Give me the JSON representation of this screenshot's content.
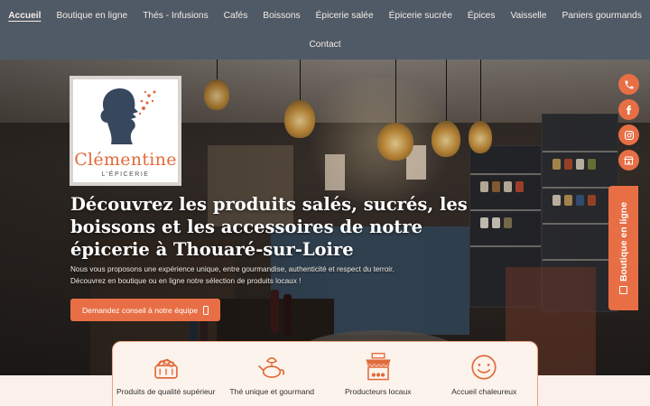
{
  "nav": {
    "items": [
      {
        "label": "Accueil",
        "active": true
      },
      {
        "label": "Boutique en ligne"
      },
      {
        "label": "Thés - Infusions"
      },
      {
        "label": "Cafés"
      },
      {
        "label": "Boissons"
      },
      {
        "label": "Épicerie salée"
      },
      {
        "label": "Épicerie sucrée"
      },
      {
        "label": "Épices"
      },
      {
        "label": "Vaisselle"
      },
      {
        "label": "Paniers gourmands"
      }
    ],
    "contact_label": "Contact"
  },
  "logo": {
    "name": "Clémentine",
    "subtitle": "L'ÉPICERIE"
  },
  "hero": {
    "title": "Découvrez les produits salés, sucrés, les boissons et les accessoires de notre épicerie à Thouaré-sur-Loire",
    "text_line1": "Nous vous proposons une expérience unique, entre gourmandise, authenticité et respect du terroir.",
    "text_line2": "Découvrez en boutique ou en ligne notre sélection de produits locaux !",
    "cta_label": "Demandez conseil à notre équipe"
  },
  "side": {
    "icons": [
      "phone-icon",
      "facebook-icon",
      "instagram-icon",
      "shop-icon"
    ],
    "tab_label": "Boutique en ligne"
  },
  "features": [
    {
      "label": "Produits de qualité supérieur",
      "icon": "basket-icon"
    },
    {
      "label": "Thé unique et gourmand",
      "icon": "teapot-icon"
    },
    {
      "label": "Producteurs locaux",
      "icon": "market-stall-icon"
    },
    {
      "label": "Accueil chaleureux",
      "icon": "smiley-icon"
    }
  ],
  "colors": {
    "nav_bg": "#4f5a66",
    "accent": "#e86f45",
    "page_bg": "#fbf1ea"
  }
}
